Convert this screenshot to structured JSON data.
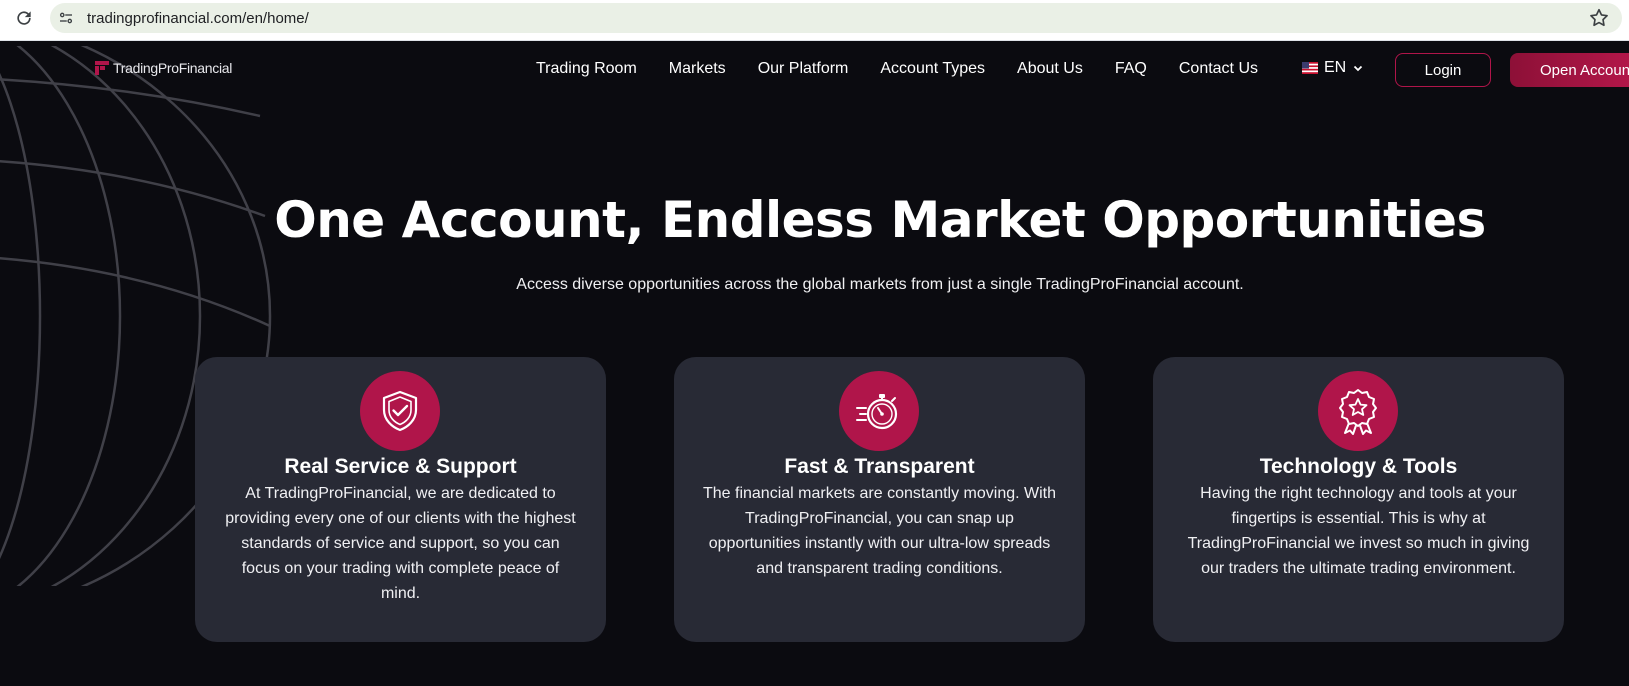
{
  "browser": {
    "url": "tradingprofinancial.com/en/home/"
  },
  "nav": {
    "logo_text": "TradingProFinancial",
    "items": [
      {
        "label": "Trading Room"
      },
      {
        "label": "Markets"
      },
      {
        "label": "Our Platform"
      },
      {
        "label": "Account Types"
      },
      {
        "label": "About Us"
      },
      {
        "label": "FAQ"
      },
      {
        "label": "Contact Us"
      }
    ],
    "language": "EN",
    "login_label": "Login",
    "open_account_label": "Open Account"
  },
  "hero": {
    "title": "One Account, Endless Market Opportunities",
    "subtitle": "Access diverse opportunities across the global markets from just a single TradingProFinancial account."
  },
  "features": [
    {
      "icon": "shield-check-icon",
      "title": "Real Service & Support",
      "text": "At TradingProFinancial, we are dedicated to providing every one of our clients with the highest standards of service and support, so you can focus on your trading with complete peace of mind."
    },
    {
      "icon": "stopwatch-icon",
      "title": "Fast & Transparent",
      "text": "The financial markets are constantly moving. With TradingProFinancial, you can snap up opportunities instantly with our ultra-low spreads and transparent trading conditions."
    },
    {
      "icon": "award-badge-icon",
      "title": "Technology & Tools",
      "text": "Having the right technology and tools at your fingertips is essential. This is why at TradingProFinancial we invest so much in giving our traders the ultimate trading environment."
    }
  ],
  "colors": {
    "background": "#0b0b10",
    "card": "#282a35",
    "accent": "#b0154a"
  }
}
